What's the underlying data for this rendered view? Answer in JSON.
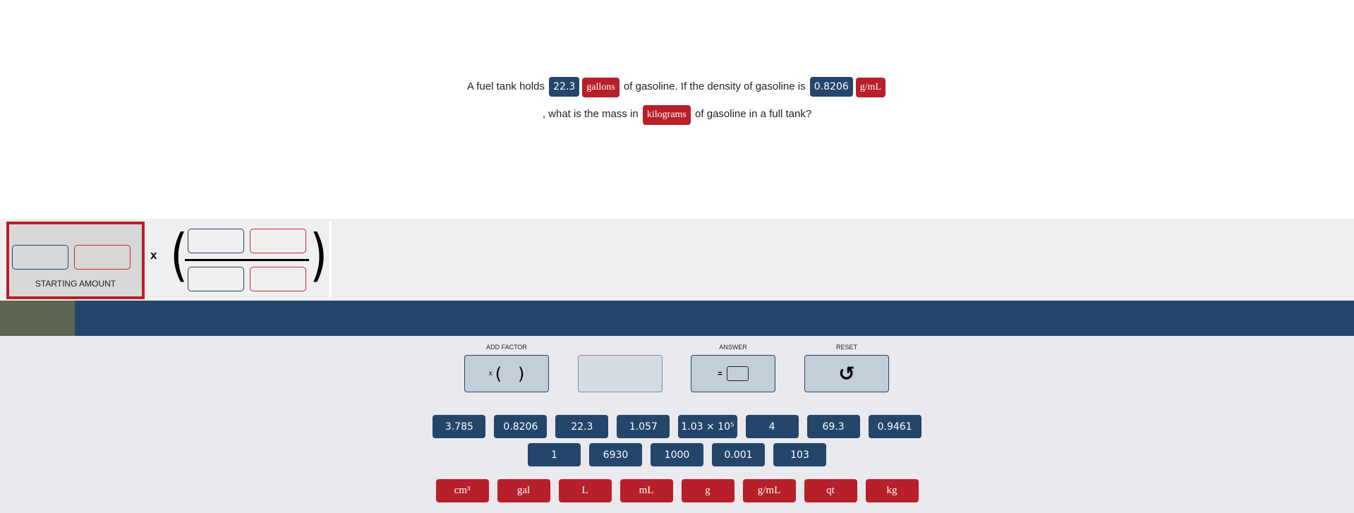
{
  "question": {
    "part1": "A fuel tank holds",
    "value1": "22.3",
    "unit1": "gallons",
    "part2": "of gasoline. If the density of gasoline is",
    "value2": "0.8206",
    "unit2": "g/mL",
    "part3": ", what is the mass in",
    "unit3": "kilograms",
    "part4": "of gasoline in a full tank?"
  },
  "workspace": {
    "starting_label": "STARTING AMOUNT",
    "times": "x"
  },
  "progress": {
    "fraction": 0.055
  },
  "controls": {
    "add_factor": "ADD FACTOR",
    "add_factor_icon": "x",
    "answer": "ANSWER",
    "answer_icon": "=",
    "reset": "RESET",
    "reset_icon": "↺"
  },
  "numbers": [
    "3.785",
    "0.8206",
    "22.3",
    "1.057",
    "1.03 × 10⁵",
    "4",
    "69.3",
    "0.9461",
    "1",
    "6930",
    "1000",
    "0.001",
    "103"
  ],
  "units": [
    "cm³",
    "gal",
    "L",
    "mL",
    "g",
    "g/mL",
    "qt",
    "kg"
  ],
  "colors": {
    "number": "#23466a",
    "unit": "#b71f29"
  }
}
